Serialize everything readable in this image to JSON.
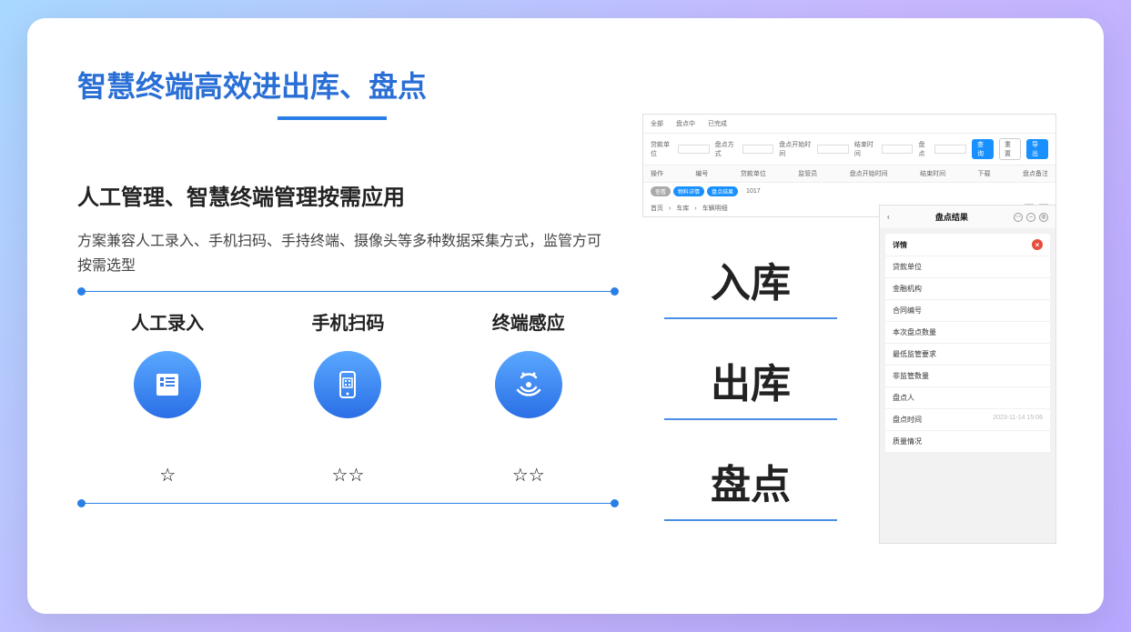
{
  "title": "智慧终端高效进出库、盘点",
  "subtitle": "人工管理、智慧终端管理按需应用",
  "desc": "方案兼容人工录入、手机扫码、手持终端、摄像头等多种数据采集方式，监管方可按需选型",
  "methods": {
    "manual": {
      "label": "人工录入",
      "stars": "☆"
    },
    "scan": {
      "label": "手机扫码",
      "stars": "☆☆"
    },
    "sense": {
      "label": "终端感应",
      "stars": "☆☆"
    }
  },
  "operations": {
    "in": "入库",
    "out": "出库",
    "check": "盘点"
  },
  "mock_top": {
    "tabs": [
      "全部",
      "盘点中",
      "已完成"
    ],
    "filter_labels": {
      "org": "贷款单位",
      "method": "盘点方式",
      "start": "盘点开始时间",
      "end": "结束时间",
      "operator": "盘点"
    },
    "btn_search": "查询",
    "btn_reset": "重置",
    "btn_export": "导出",
    "headers": [
      "操作",
      "编号",
      "贷款单位",
      "监管员",
      "盘点开始时间",
      "结束时间",
      "下载",
      "盘点备注"
    ],
    "row_actions": [
      "查看",
      "物料详情",
      "盘点结果"
    ],
    "row_id": "1017",
    "crumbs": [
      "首页",
      "车库",
      "车辆明细"
    ],
    "page": "1"
  },
  "mock_phone": {
    "title": "盘点结果",
    "section": "详情",
    "rows": [
      {
        "k": "贷款单位",
        "v": ""
      },
      {
        "k": "金融机构",
        "v": ""
      },
      {
        "k": "合同编号",
        "v": ""
      },
      {
        "k": "本次盘点数量",
        "v": ""
      },
      {
        "k": "最低监管要求",
        "v": ""
      },
      {
        "k": "非监管数量",
        "v": ""
      },
      {
        "k": "盘点人",
        "v": ""
      },
      {
        "k": "盘点时间",
        "v": "2023-11-14 15:06"
      },
      {
        "k": "质量情况",
        "v": ""
      }
    ]
  }
}
